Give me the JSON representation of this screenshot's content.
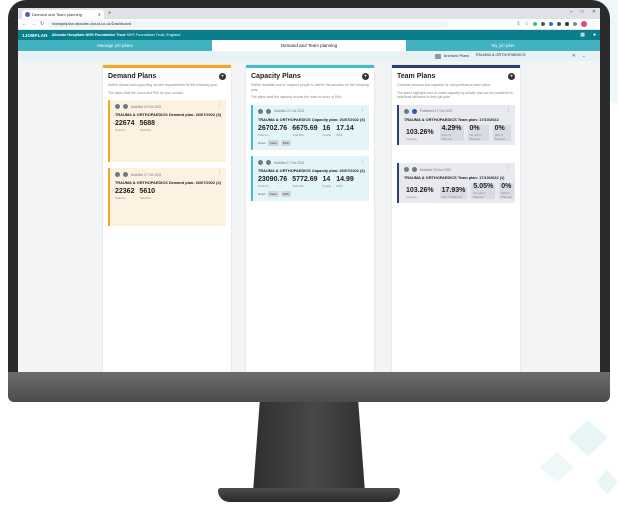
{
  "browser": {
    "tab_title": "Demand and Team planning",
    "new_tab": "+",
    "url": "teamjobplan.allocate-cloud.co.uk/Dashboard",
    "window_controls": [
      "–",
      "□",
      "✕"
    ]
  },
  "app": {
    "logo": "1JOBPLAN",
    "org_bold": "Allocate Hospitals NHS Foundation Trust",
    "org_rest": "NHS Foundation Trust, England"
  },
  "modules": [
    {
      "label": "Manage job plans",
      "active": false
    },
    {
      "label": "Demand and Team planning",
      "active": true
    },
    {
      "label": "My job plan",
      "active": false
    }
  ],
  "subbar": {
    "archived_label": "Archived Plans",
    "specialty": "TRAUMA & ORTHOPAEDICS"
  },
  "demand": {
    "title": "Demand Plans",
    "desc1": "Define clinical and supporting service requirements for the following year.",
    "desc2": "The plans total the hours and PAs for your service.",
    "cards": [
      {
        "meta": "Modified 20 Oct 2022",
        "title": "TRAUMA & ORTHOPAEDICS Demand plan: 26/07/2022 (3)",
        "hours": "22674",
        "hours_label": "Total hrs",
        "pas": "5688",
        "pas_label": "Total PAs"
      },
      {
        "meta": "Modified 17 Oct 2022",
        "title": "TRAUMA & ORTHOPAEDICS Demand plan: 26/07/2022 (2)",
        "hours": "22362",
        "hours_label": "Total hrs",
        "pas": "5610",
        "pas_label": "Total PAs"
      }
    ]
  },
  "capacity": {
    "title": "Capacity Plans",
    "desc1": "Define available and or required people to deliver the services for the following year.",
    "desc2": "The plans total the capacity across the roles in hours or PAs.",
    "cards": [
      {
        "meta": "Modified 21 Oct 2022",
        "title": "TRAUMA & ORTHOPAEDICS Capacity plan: 26/07/2022 (3)",
        "hours": "26702.76",
        "hours_label": "Total hrs",
        "pas": "6675.69",
        "pas_label": "Total PAs",
        "people": "16",
        "people_label": "People",
        "wte": "17.14",
        "wte_label": "WTE",
        "roles_label": "Roles",
        "chips": [
          "Cons",
          "SAS"
        ]
      },
      {
        "meta": "Modified 17 Oct 2022",
        "title": "TRAUMA & ORTHOPAEDICS Capacity plan: 26/07/2022 (2)",
        "hours": "23090.76",
        "hours_label": "Total hrs",
        "pas": "5772.69",
        "pas_label": "Total PAs",
        "people": "14",
        "people_label": "People",
        "wte": "14.99",
        "wte_label": "WTE",
        "roles_label": "Roles",
        "chips": [
          "Cons",
          "SAS"
        ]
      }
    ]
  },
  "team": {
    "title": "Team Plans",
    "desc1": "Combine demand and capacity for comprehensive team plans.",
    "desc2": "The plans highlight over or under capacity by activity and can be published to individual clinicians in their job plan.",
    "cards": [
      {
        "meta": "Published 17 Oct 2022",
        "title": "TRAUMA & ORTHOPAEDICS Team plan: 17/10/2022",
        "capacity": "103.26%",
        "capacity_label": "Capacity",
        "dcc": "4.29%",
        "dcc_label": "DCC % Planned",
        "oncall": "0%",
        "oncall_label": "On-call % Planned",
        "spa": "0%",
        "spa_label": "SPA % Planned"
      },
      {
        "meta": "Modified 20 Nov 2022",
        "title": "TRAUMA & ORTHOPAEDICS Team plan: 17/10/2022 (1)",
        "capacity": "103.26%",
        "capacity_label": "Capacity",
        "dcc": "17.93%",
        "dcc_label": "DCC % Planned",
        "oncall": "5.05%",
        "oncall_label": "On-call % Planned",
        "spa": "0%",
        "spa_label": "SPA % Planned"
      }
    ]
  }
}
